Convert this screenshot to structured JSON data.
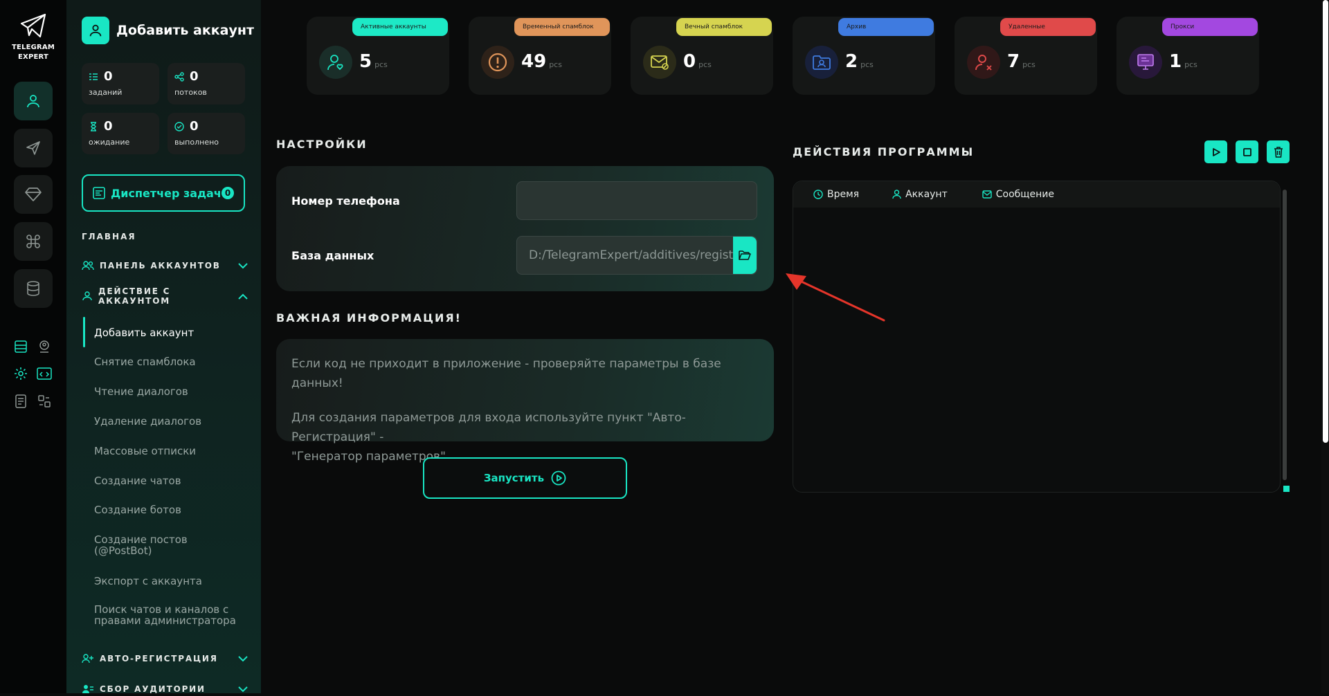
{
  "logo": {
    "line1": "TELEGRAM",
    "line2": "EXPERT"
  },
  "sidebar": {
    "title": "Добавить аккаунт",
    "stats": [
      {
        "value": "0",
        "label": "заданий"
      },
      {
        "value": "0",
        "label": "потоков"
      },
      {
        "value": "0",
        "label": "ожидание"
      },
      {
        "value": "0",
        "label": "выполнено"
      }
    ],
    "dispatcher_label": "Диспетчер задач",
    "dispatcher_count": "0",
    "section_main": "ГЛАВНАЯ",
    "group_accounts_panel": "ПАНЕЛЬ АККАУНТОВ",
    "group_account_actions": "ДЕЙСТВИЕ С АККАУНТОМ",
    "items": [
      "Добавить аккаунт",
      "Снятие спамблока",
      "Чтение диалогов",
      "Удаление диалогов",
      "Массовые отписки",
      "Создание чатов",
      "Создание ботов",
      "Создание постов (@PostBot)",
      "Экспорт с аккаунта",
      "Поиск чатов и каналов с правами администратора"
    ],
    "group_auto_reg": "АВТО-РЕГИСТРАЦИЯ",
    "group_audience": "СБОР АУДИТОРИИ"
  },
  "cards": [
    {
      "label": "Активные аккаунты",
      "value": "5",
      "unit": "pcs",
      "color": "#1de9c6"
    },
    {
      "label": "Временный спамблок",
      "value": "49",
      "unit": "pcs",
      "color": "#e0955a"
    },
    {
      "label": "Вечный спамблок",
      "value": "0",
      "unit": "pcs",
      "color": "#d6d450"
    },
    {
      "label": "Архив",
      "value": "2",
      "unit": "pcs",
      "color": "#3f7be0"
    },
    {
      "label": "Удаленные",
      "value": "7",
      "unit": "pcs",
      "color": "#e04a4a"
    },
    {
      "label": "Прокси",
      "value": "1",
      "unit": "pcs",
      "color": "#a348e0"
    }
  ],
  "settings": {
    "title": "НАСТРОЙКИ",
    "phone_label": "Номер телефона",
    "phone_value": "",
    "db_label": "База данных",
    "db_value": "D:/TelegramExpert/additives/registrat"
  },
  "info": {
    "title": "ВАЖНАЯ ИНФОРМАЦИЯ!",
    "line1": "Если код не приходит в приложение - проверяйте параметры в базе данных!",
    "line2": "Для создания параметров для входа используйте пункт \"Авто-Регистрация\" -",
    "line3": "\"Генератор параметров\"."
  },
  "launch_label": "Запустить",
  "log": {
    "title": "ДЕЙСТВИЯ ПРОГРАММЫ",
    "col_time": "Время",
    "col_account": "Аккаунт",
    "col_message": "Сообщение"
  },
  "accent": "#19e6c4",
  "arrow_color": "#e5352a"
}
